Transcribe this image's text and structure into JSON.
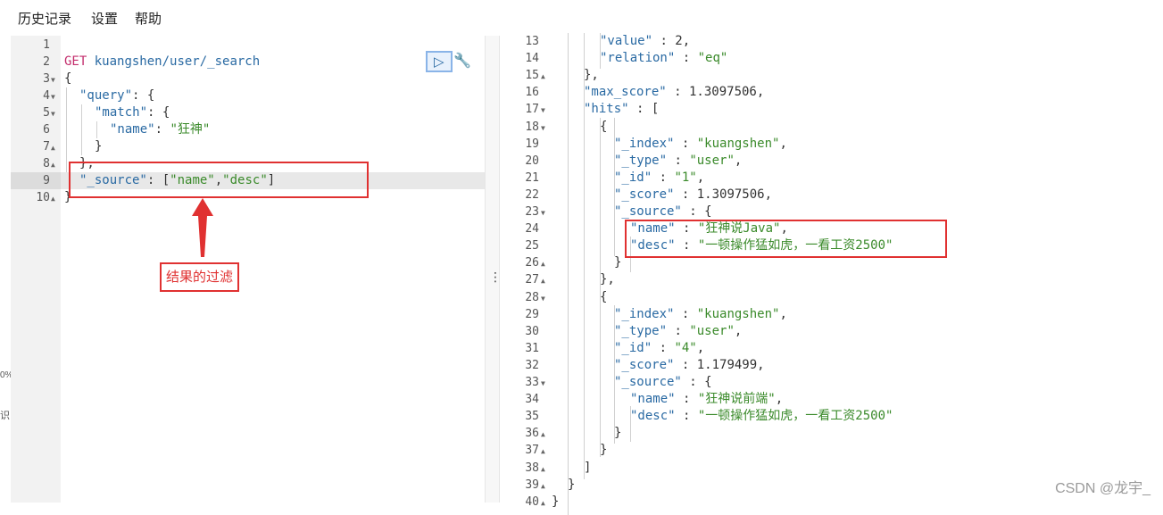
{
  "menu": {
    "history": "历史记录",
    "settings": "设置",
    "help": "帮助"
  },
  "sidebar_strip": {
    "percent": "0%",
    "text": "识"
  },
  "editor": {
    "line_numbers": [
      "1",
      "2",
      "3",
      "4",
      "5",
      "6",
      "7",
      "8",
      "9",
      "10"
    ],
    "method": "GET",
    "path": "kuangshen/user/_search",
    "lines": {
      "l3": "{",
      "l4_key": "\"query\"",
      "l4_rest": ": {",
      "l5_key": "\"match\"",
      "l5_rest": ": {",
      "l6_key": "\"name\"",
      "l6_colon": ": ",
      "l6_val": "\"狂神\"",
      "l7": "}",
      "l8": "},",
      "l9_key": "\"_source\"",
      "l9_colon": ": [",
      "l9_v1": "\"name\"",
      "l9_comma": ",",
      "l9_v2": "\"desc\"",
      "l9_close": "]",
      "l10": "}"
    },
    "annotation": "结果的过滤"
  },
  "result": {
    "line_numbers": [
      "13",
      "14",
      "15",
      "16",
      "17",
      "18",
      "19",
      "20",
      "21",
      "22",
      "23",
      "24",
      "25",
      "26",
      "27",
      "28",
      "29",
      "30",
      "31",
      "32",
      "33",
      "34",
      "35",
      "36",
      "37",
      "38",
      "39",
      "40"
    ],
    "r13_key": "\"value\"",
    "r13_rest": " : 2,",
    "r14_key": "\"relation\"",
    "r14_sep": " : ",
    "r14_val": "\"eq\"",
    "r15": "},",
    "r16_key": "\"max_score\"",
    "r16_rest": " : 1.3097506,",
    "r17_key": "\"hits\"",
    "r17_rest": " : [",
    "r18": "{",
    "r19_key": "\"_index\"",
    "r19_sep": " : ",
    "r19_val": "\"kuangshen\"",
    "r19_end": ",",
    "r20_key": "\"_type\"",
    "r20_sep": " : ",
    "r20_val": "\"user\"",
    "r20_end": ",",
    "r21_key": "\"_id\"",
    "r21_sep": " : ",
    "r21_val": "\"1\"",
    "r21_end": ",",
    "r22_key": "\"_score\"",
    "r22_rest": " : 1.3097506,",
    "r23_key": "\"_source\"",
    "r23_rest": " : {",
    "r24_key": "\"name\"",
    "r24_sep": " : ",
    "r24_val": "\"狂神说Java\"",
    "r24_end": ",",
    "r25_key": "\"desc\"",
    "r25_sep": " : ",
    "r25_val": "\"一顿操作猛如虎，一看工资2500\"",
    "r26": "}",
    "r27": "},",
    "r28": "{",
    "r29_key": "\"_index\"",
    "r29_sep": " : ",
    "r29_val": "\"kuangshen\"",
    "r29_end": ",",
    "r30_key": "\"_type\"",
    "r30_sep": " : ",
    "r30_val": "\"user\"",
    "r30_end": ",",
    "r31_key": "\"_id\"",
    "r31_sep": " : ",
    "r31_val": "\"4\"",
    "r31_end": ",",
    "r32_key": "\"_score\"",
    "r32_rest": " : 1.179499,",
    "r33_key": "\"_source\"",
    "r33_rest": " : {",
    "r34_key": "\"name\"",
    "r34_sep": " : ",
    "r34_val": "\"狂神说前端\"",
    "r34_end": ",",
    "r35_key": "\"desc\"",
    "r35_sep": " : ",
    "r35_val": "\"一顿操作猛如虎，一看工资2500\"",
    "r36": "}",
    "r37": "}",
    "r38": "]",
    "r39": "}",
    "r40": "}"
  },
  "watermark": "CSDN @龙宇_",
  "icons": {
    "run": "play-icon",
    "settings": "wrench-icon",
    "close": "close-icon",
    "more": "vertical-dots-icon"
  },
  "colors": {
    "highlight_box": "#e03131",
    "key": "#2a6aa3",
    "string": "#3a8a2a",
    "method": "#c32c6c"
  }
}
